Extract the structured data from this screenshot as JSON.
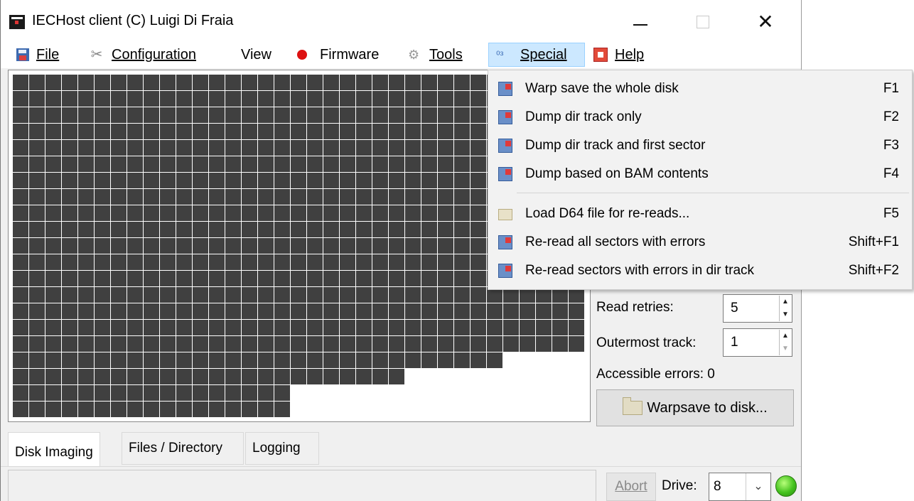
{
  "window": {
    "title": "IECHost client (C) Luigi Di Fraia"
  },
  "menu": {
    "file": "File",
    "configuration": "Configuration",
    "view": "View",
    "firmware": "Firmware",
    "tools": "Tools",
    "special": "Special",
    "help": "Help"
  },
  "special_menu": {
    "items": [
      {
        "label": "Warp save the whole disk",
        "shortcut": "F1",
        "icon": "disk-red-icon"
      },
      {
        "label": "Dump dir track only",
        "shortcut": "F2",
        "icon": "disk-red-icon"
      },
      {
        "label": "Dump dir track and first sector",
        "shortcut": "F3",
        "icon": "disk-red-icon"
      },
      {
        "label": "Dump based on BAM contents",
        "shortcut": "F4",
        "icon": "disk-red-icon"
      },
      {
        "label": "Load D64 file for re-reads...",
        "shortcut": "F5",
        "icon": "folder-icon"
      },
      {
        "label": "Re-read all sectors with errors",
        "shortcut": "Shift+F1",
        "icon": "disk-red-icon"
      },
      {
        "label": "Re-read sectors with errors in dir track",
        "shortcut": "Shift+F2",
        "icon": "disk-red-icon"
      }
    ]
  },
  "settings": {
    "read_retries_label": "Read retries:",
    "read_retries_value": "5",
    "outermost_track_label": "Outermost track:",
    "outermost_track_value": "1",
    "accessible_errors_label": "Accessible errors: 0",
    "warpsave_button": "Warpsave to disk..."
  },
  "tabs": [
    "Disk Imaging",
    "Files / Directory",
    "Logging"
  ],
  "status": {
    "abort_label": "Abort",
    "drive_label": "Drive:",
    "drive_value": "8"
  },
  "sector_map": {
    "tracks": 35,
    "rows_sectors_by_zone": [
      21,
      19,
      18,
      17
    ],
    "cell_color": "#404040",
    "gap_color": "#ffffff"
  },
  "colors": {
    "menu_active": "#cce8ff",
    "led": "#44c21e"
  }
}
